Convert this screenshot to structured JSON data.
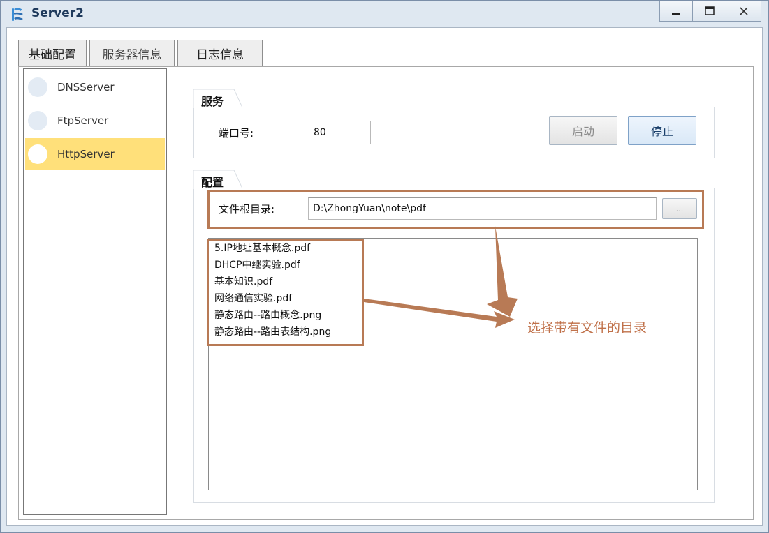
{
  "window": {
    "title": "Server2"
  },
  "titlebar_buttons": {
    "minimize": "–",
    "maximize": "☐",
    "close": "X"
  },
  "tabs": [
    {
      "label": "基础配置",
      "active": true
    },
    {
      "label": "服务器信息",
      "active": false
    },
    {
      "label": "日志信息",
      "active": false
    }
  ],
  "servers": [
    {
      "label": "DNSServer",
      "selected": false
    },
    {
      "label": "FtpServer",
      "selected": false
    },
    {
      "label": "HttpServer",
      "selected": true
    }
  ],
  "service_group": {
    "title": "服务",
    "port_label": "端口号:",
    "port_value": "80",
    "start_label": "启动",
    "stop_label": "停止"
  },
  "config_group": {
    "title": "配置",
    "root_label": "文件根目录:",
    "root_value": "D:\\ZhongYuan\\note\\pdf",
    "browse_label": "...",
    "files": [
      "5.IP地址基本概念.pdf",
      "DHCP中继实验.pdf",
      "基本知识.pdf",
      "网络通信实验.pdf",
      "静态路由--路由概念.png",
      "静态路由--路由表结构.png"
    ]
  },
  "annotation": {
    "text": "选择带有文件的目录"
  },
  "colors": {
    "selected_bg": "#ffe07a",
    "annotation": "#c0714a",
    "titlebar": "#dfe8f1"
  }
}
